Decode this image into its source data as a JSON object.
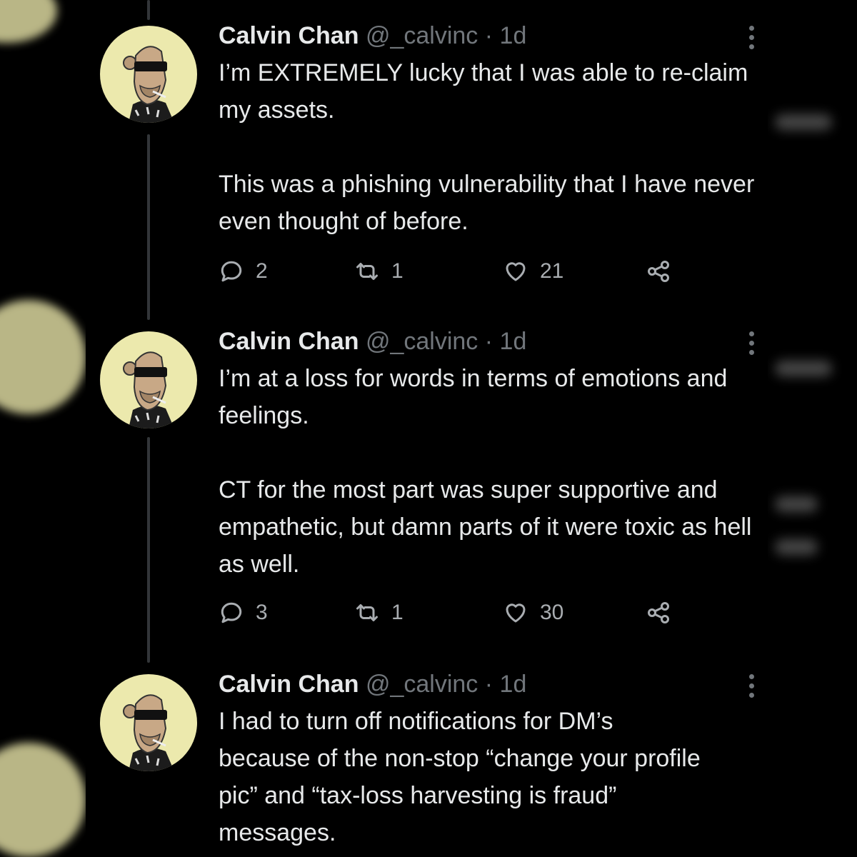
{
  "tweets": [
    {
      "name": "Calvin Chan",
      "handle": "@_calvinc",
      "separator": "·",
      "time": "1d",
      "paragraphs": [
        "I’m EXTREMELY lucky that I was able to re-claim my assets.",
        "This was a phishing vulnerability that I have never even thought of before."
      ],
      "replies": "2",
      "retweets": "1",
      "likes": "21"
    },
    {
      "name": "Calvin Chan",
      "handle": "@_calvinc",
      "separator": "·",
      "time": "1d",
      "paragraphs": [
        "I’m at a loss for words in terms of emotions and feelings.",
        "CT for the most part was super supportive and empathetic, but damn parts of it were toxic as hell as well."
      ],
      "replies": "3",
      "retweets": "1",
      "likes": "30"
    },
    {
      "name": "Calvin Chan",
      "handle": "@_calvinc",
      "separator": "·",
      "time": "1d",
      "paragraphs": [
        "I had to turn off notifications for DM’s because of the non-stop “change your profile pic” and “tax-loss harvesting is fraud” messages."
      ]
    }
  ],
  "icons": {
    "reply": "reply-icon",
    "retweet": "retweet-icon",
    "like": "heart-icon",
    "share": "share-icon",
    "more": "more-options-icon",
    "avatar": "bored-ape-avatar"
  },
  "colors": {
    "background": "#000000",
    "text": "#e7e9ea",
    "secondary": "#71767b",
    "avatar_bg": "#ece9ad"
  }
}
